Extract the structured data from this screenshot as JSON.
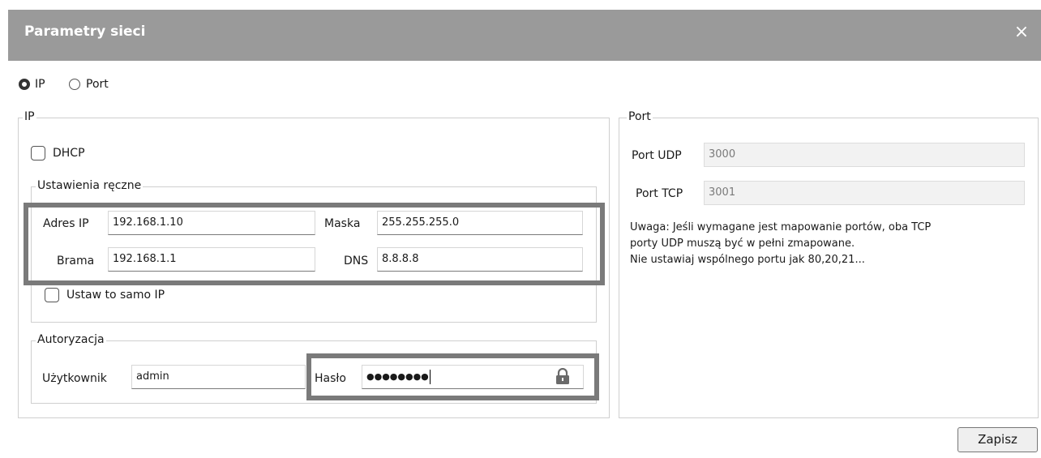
{
  "dialog": {
    "title": "Parametry sieci",
    "close_icon": "×"
  },
  "mode": {
    "ip_label": "IP",
    "port_label": "Port",
    "selected": "IP"
  },
  "ip_group": {
    "legend": "IP",
    "dhcp_label": "DHCP",
    "dhcp_checked": false,
    "manual": {
      "legend": "Ustawienia ręczne",
      "ip_label": "Adres IP",
      "ip_value": "192.168.1.10",
      "mask_label": "Maska",
      "mask_value": "255.255.255.0",
      "gateway_label": "Brama",
      "gateway_value": "192.168.1.1",
      "dns_label": "DNS",
      "dns_value": "8.8.8.8",
      "same_ip_label": "Ustaw to samo IP",
      "same_ip_checked": false
    },
    "auth": {
      "legend": "Autoryzacja",
      "user_label": "Użytkownik",
      "user_value": "admin",
      "password_label": "Hasło",
      "password_masked": "●●●●●●●●",
      "lock_icon": "lock-icon"
    }
  },
  "port_group": {
    "legend": "Port",
    "udp_label": "Port UDP",
    "udp_value": "3000",
    "tcp_label": "Port TCP",
    "tcp_value": "3001",
    "note_lines": [
      "Uwaga: Jeśli wymagane jest mapowanie portów, oba TCP",
      "porty UDP muszą być w pełni zmapowane.",
      "Nie ustawiaj wspólnego portu jak 80,20,21..."
    ]
  },
  "footer": {
    "save_label": "Zapisz"
  },
  "colors": {
    "titlebar": "#9a9a9a",
    "highlight_frame": "#7a7a7a"
  }
}
